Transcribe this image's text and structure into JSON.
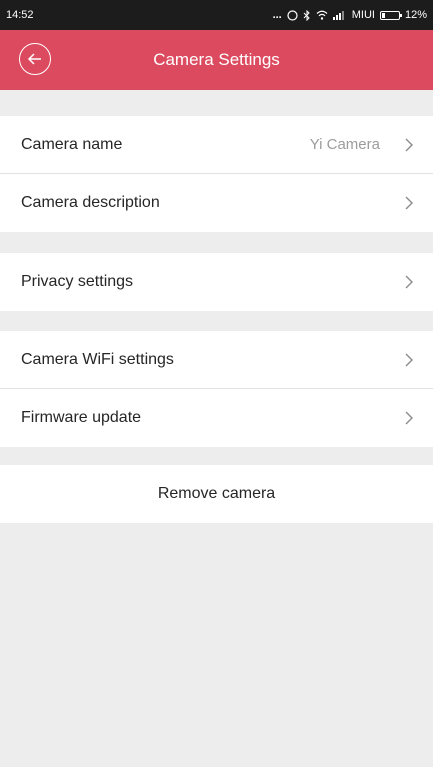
{
  "status_bar": {
    "time": "14:52",
    "carrier": "MIUI",
    "battery": "12%",
    "dots": "...",
    "icons": [
      "circle-icon",
      "bluetooth-icon",
      "wifi-icon",
      "signal-icon",
      "battery-icon"
    ]
  },
  "header": {
    "title": "Camera Settings",
    "back_icon": "back-arrow-icon",
    "color": "#dc4a5f"
  },
  "settings": {
    "camera_name": {
      "label": "Camera name",
      "value": "Yi Camera"
    },
    "camera_description": {
      "label": "Camera description"
    },
    "privacy": {
      "label": "Privacy settings"
    },
    "wifi": {
      "label": "Camera WiFi settings"
    },
    "firmware": {
      "label": "Firmware update"
    }
  },
  "remove_button": {
    "label": "Remove camera"
  }
}
